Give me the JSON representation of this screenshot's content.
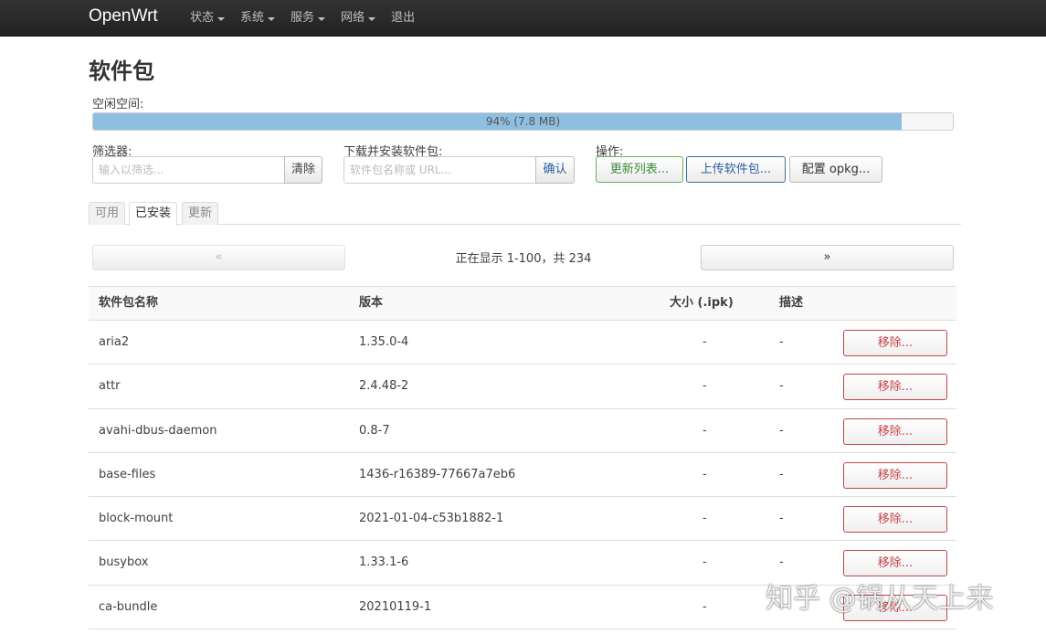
{
  "navbar": {
    "brand": "OpenWrt",
    "menu": [
      {
        "label": "状态",
        "dropdown": true
      },
      {
        "label": "系统",
        "dropdown": true
      },
      {
        "label": "服务",
        "dropdown": true
      },
      {
        "label": "网络",
        "dropdown": true
      },
      {
        "label": "退出",
        "dropdown": false
      }
    ]
  },
  "page_title": "软件包",
  "free_space": {
    "label": "空闲空间:",
    "percent": 94,
    "text": "94% (7.8 MB)"
  },
  "filter": {
    "label": "筛选器:",
    "placeholder": "输入以筛选...",
    "clear_label": "清除"
  },
  "install": {
    "label": "下载并安装软件包:",
    "placeholder": "软件包名称或 URL...",
    "confirm_label": "确认"
  },
  "actions": {
    "label": "操作:",
    "update_lists": "更新列表...",
    "upload_package": "上传软件包...",
    "configure_opkg": "配置 opkg..."
  },
  "tabs": [
    "可用",
    "已安装",
    "更新"
  ],
  "active_tab": "已安装",
  "pager": {
    "prev": "«",
    "next": "»",
    "status": "正在显示 1-100，共 234"
  },
  "table": {
    "headers": {
      "name": "软件包名称",
      "version": "版本",
      "size": "大小 (.ipk)",
      "description": "描述"
    },
    "remove_label": "移除...",
    "rows": [
      {
        "name": "aria2",
        "version": "1.35.0-4",
        "size": "-",
        "description": "-"
      },
      {
        "name": "attr",
        "version": "2.4.48-2",
        "size": "-",
        "description": "-"
      },
      {
        "name": "avahi-dbus-daemon",
        "version": "0.8-7",
        "size": "-",
        "description": "-"
      },
      {
        "name": "base-files",
        "version": "1436-r16389-77667a7eb6",
        "size": "-",
        "description": "-"
      },
      {
        "name": "block-mount",
        "version": "2021-01-04-c53b1882-1",
        "size": "-",
        "description": "-"
      },
      {
        "name": "busybox",
        "version": "1.33.1-6",
        "size": "-",
        "description": "-"
      },
      {
        "name": "ca-bundle",
        "version": "20210119-1",
        "size": "-",
        "description": "-"
      }
    ]
  },
  "watermark": "知乎 @锅从天上来",
  "colors": {
    "navbar_bg": "#222222",
    "progress_fill": "#8fbfe0",
    "success_border": "#5cb85c",
    "success_text": "#3c8a3c",
    "primary_border": "#3a6ea5",
    "danger": "#c7444a",
    "link_blue": "#2a5d9e"
  }
}
